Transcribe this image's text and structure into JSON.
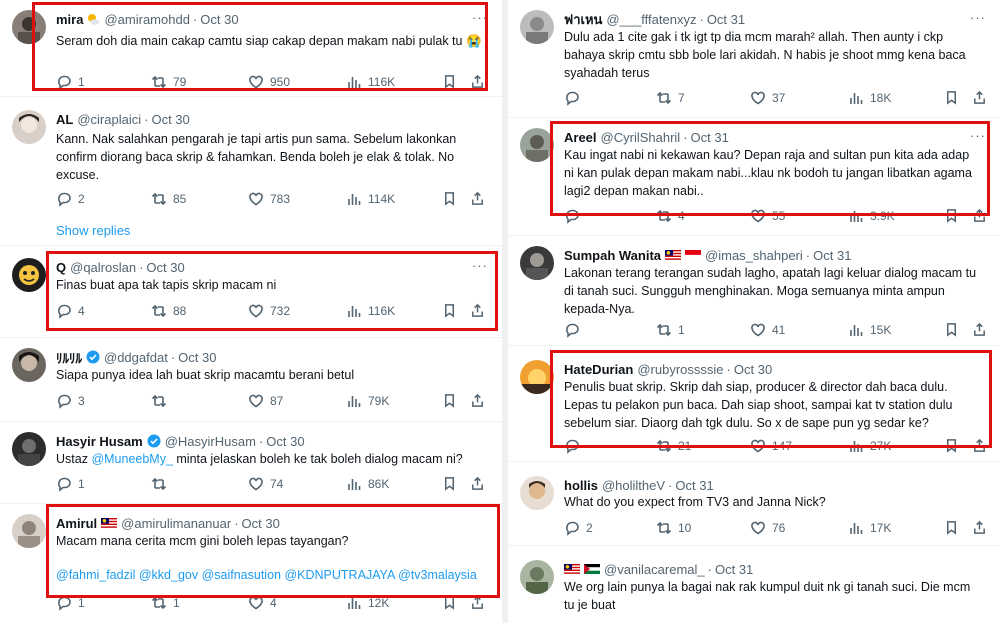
{
  "left": [
    {
      "name": "mira",
      "handle": "@amiramohdd",
      "time": "Oct 30",
      "text": "Seram doh dia main cakap camtu siap cakap depan makam nabi pulak tu 😭",
      "replies": "1",
      "retweets": "79",
      "likes": "950",
      "views": "116K"
    },
    {
      "name": "AL",
      "handle": "@ciraplaici",
      "time": "Oct 30",
      "text": "Kann. Nak salahkan pengarah je tapi artis pun sama. Sebelum lakonkan confirm diorang baca skrip & fahamkan. Benda boleh je elak & tolak. No excuse.",
      "replies": "2",
      "retweets": "85",
      "likes": "783",
      "views": "114K",
      "show_replies": "Show replies"
    },
    {
      "name": "Q",
      "handle": "@qalroslan",
      "time": "Oct 30",
      "text": "Finas buat apa tak tapis skrip macam ni",
      "replies": "4",
      "retweets": "88",
      "likes": "732",
      "views": "116K"
    },
    {
      "name": "ﾘﾙﾘﾙ",
      "handle": "@ddgafdat",
      "time": "Oct 30",
      "text": "Siapa punya idea lah buat skrip macamtu berani betul",
      "replies": "3",
      "retweets": "",
      "likes": "87",
      "views": "79K"
    },
    {
      "name": "Hasyir Husam",
      "handle": "@HasyirHusam",
      "time": "Oct 30",
      "text_pre": "Ustaz ",
      "mention": "@MuneebMy_",
      "text_post": "  minta jelaskan boleh ke tak boleh dialog macam ni?",
      "replies": "1",
      "retweets": "",
      "likes": "74",
      "views": "86K"
    },
    {
      "name": "Amirul",
      "handle": "@amirulimananuar",
      "time": "Oct 30",
      "text": "Macam mana cerita mcm gini boleh lepas tayangan?",
      "tags": "@fahmi_fadzil @kkd_gov @saifnasution @KDNPUTRAJAYA @tv3malaysia",
      "replies": "1",
      "retweets": "1",
      "likes": "4",
      "views": "12K"
    }
  ],
  "right": [
    {
      "name": "ฟาเหน",
      "handle": "@___fffatenxyz",
      "time": "Oct 31",
      "text": "Dulu ada 1 cite gak i tk igt tp dia mcm marah² allah. Then aunty i ckp bahaya skrip cmtu sbb bole lari akidah. N habis je shoot mmg kena baca syahadah terus",
      "replies": "",
      "retweets": "7",
      "likes": "37",
      "views": "18K"
    },
    {
      "name": "Areel",
      "handle": "@CyrilShahril",
      "time": "Oct 31",
      "text": "Kau ingat nabi ni kekawan kau? Depan raja and sultan pun kita ada adap ni kan pulak depan makam nabi...klau nk bodoh tu jangan libatkan agama lagi2 depan makan nabi..",
      "replies": "",
      "retweets": "4",
      "likes": "55",
      "views": "3.9K"
    },
    {
      "name": "Sumpah Wanita",
      "handle": "@imas_shahperi",
      "time": "Oct 31",
      "text": "Lakonan terang terangan sudah lagho, apatah lagi keluar dialog macam tu di tanah suci. Sungguh menghinakan. Moga semuanya minta ampun kepada-Nya.",
      "replies": "",
      "retweets": "1",
      "likes": "41",
      "views": "15K"
    },
    {
      "name": "HateDurian",
      "handle": "@rubyrossssie",
      "time": "Oct 30",
      "text": "Penulis buat skrip. Skrip dah siap, producer & director dah baca dulu. Lepas tu pelakon pun baca. Dah siap shoot, sampai kat tv station dulu sebelum siar. Diaorg dah tgk dulu. So x de sape pun yg sedar ke?",
      "replies": "",
      "retweets": "21",
      "likes": "147",
      "views": "27K"
    },
    {
      "name": "hollis",
      "handle": "@holiltheV",
      "time": "Oct 31",
      "text": "What do you expect from TV3 and Janna Nick?",
      "replies": "2",
      "retweets": "10",
      "likes": "76",
      "views": "17K"
    },
    {
      "name": "",
      "handle": "@vanilacaremal_",
      "time": "Oct 31",
      "text": "We org lain punya la bagai nak rak kumpul duit nk gi tanah suci. Die mcm tu je buat",
      "replies": "",
      "retweets": "",
      "likes": "",
      "views": ""
    }
  ],
  "colors": {
    "highlight": "#e01010",
    "link": "#1d9bf0",
    "muted": "#536471"
  },
  "icons": [
    "reply-icon",
    "retweet-icon",
    "like-icon",
    "views-icon",
    "bookmark-icon",
    "share-icon",
    "more-icon",
    "verified-icon"
  ]
}
